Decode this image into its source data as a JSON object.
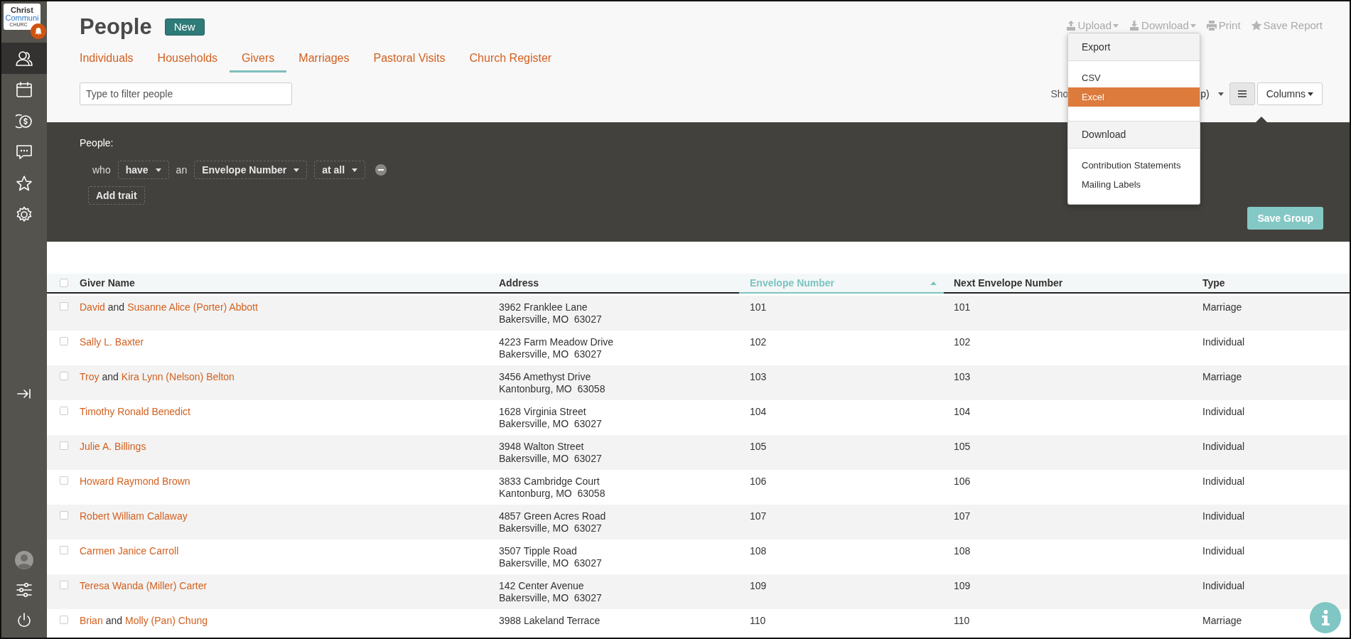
{
  "logo": {
    "lines": [
      "Christ",
      "Communi",
      "CHURC"
    ]
  },
  "sidebar": {
    "nav": [
      {
        "kind": "people",
        "selected": true
      },
      {
        "kind": "calendar",
        "selected": false
      },
      {
        "kind": "giving",
        "selected": false
      },
      {
        "kind": "messages",
        "selected": false
      },
      {
        "kind": "star",
        "selected": false
      },
      {
        "kind": "settings",
        "selected": false
      }
    ],
    "bottom": [
      {
        "kind": "avatar"
      },
      {
        "kind": "sliders"
      },
      {
        "kind": "power"
      }
    ]
  },
  "header": {
    "title": "People",
    "new_button": "New",
    "tabs": [
      {
        "label": "Individuals",
        "selected": false
      },
      {
        "label": "Households",
        "selected": false
      },
      {
        "label": "Givers",
        "selected": true
      },
      {
        "label": "Marriages",
        "selected": false
      },
      {
        "label": "Pastoral Visits",
        "selected": false
      },
      {
        "label": "Church Register",
        "selected": false
      }
    ],
    "actions": [
      {
        "kind": "upload",
        "label": "Upload",
        "caret": true
      },
      {
        "kind": "download",
        "label": "Download",
        "caret": true
      },
      {
        "kind": "print",
        "label": "Print",
        "caret": false
      },
      {
        "kind": "star",
        "label": "Save Report",
        "caret": false
      }
    ],
    "filter": {
      "placeholder": "Type to filter people"
    },
    "show_label": "Sho",
    "show_select": "p)",
    "columns_button": "Columns"
  },
  "download_menu": {
    "sections": [
      {
        "header": "Export",
        "items": [
          {
            "label": "CSV",
            "selected": false
          },
          {
            "label": "Excel",
            "selected": true
          }
        ]
      },
      {
        "header": "Download",
        "items": [
          {
            "label": "Contribution Statements",
            "selected": false
          },
          {
            "label": "Mailing Labels",
            "selected": false
          }
        ]
      }
    ]
  },
  "group_panel": {
    "heading": "People:",
    "trait": [
      {
        "kind": "word",
        "text": "who"
      },
      {
        "kind": "select",
        "text": "have"
      },
      {
        "kind": "word",
        "text": "an"
      },
      {
        "kind": "select",
        "text": "Envelope Number"
      },
      {
        "kind": "select",
        "text": "at all"
      },
      {
        "kind": "remove"
      }
    ],
    "add_trait": "Add trait",
    "save_group": {
      "label": "Save Group",
      "disabled": true
    }
  },
  "table": {
    "select_all": {
      "checked": false
    },
    "columns": [
      {
        "label": "Giver Name",
        "sorted": false
      },
      {
        "label": "Address",
        "sorted": false
      },
      {
        "label": "Envelope Number",
        "sorted": true
      },
      {
        "label": "Next Envelope Number",
        "sorted": false
      },
      {
        "label": "Type",
        "sorted": false
      }
    ],
    "rows": [
      {
        "checked": false,
        "names": [
          "David",
          "Susanne Alice (Porter) Abbott"
        ],
        "joiner": "and",
        "address": [
          "3962 Franklee Lane",
          "Bakersville, MO  63027"
        ],
        "envelope": "101",
        "next_envelope": "101",
        "type": "Marriage"
      },
      {
        "checked": false,
        "names": [
          "Sally L. Baxter"
        ],
        "address": [
          "4223 Farm Meadow Drive",
          "Bakersville, MO  63027"
        ],
        "envelope": "102",
        "next_envelope": "102",
        "type": "Individual"
      },
      {
        "checked": false,
        "names": [
          "Troy",
          "Kira Lynn (Nelson) Belton"
        ],
        "joiner": "and",
        "address": [
          "3456 Amethyst Drive",
          "Kantonburg, MO  63058"
        ],
        "envelope": "103",
        "next_envelope": "103",
        "type": "Marriage"
      },
      {
        "checked": false,
        "names": [
          "Timothy Ronald Benedict"
        ],
        "address": [
          "1628 Virginia Street",
          "Bakersville, MO  63027"
        ],
        "envelope": "104",
        "next_envelope": "104",
        "type": "Individual"
      },
      {
        "checked": false,
        "names": [
          "Julie A. Billings"
        ],
        "address": [
          "3948 Walton Street",
          "Bakersville, MO  63027"
        ],
        "envelope": "105",
        "next_envelope": "105",
        "type": "Individual"
      },
      {
        "checked": false,
        "names": [
          "Howard Raymond Brown"
        ],
        "address": [
          "3833 Cambridge Court",
          "Kantonburg, MO  63058"
        ],
        "envelope": "106",
        "next_envelope": "106",
        "type": "Individual"
      },
      {
        "checked": false,
        "names": [
          "Robert William Callaway"
        ],
        "address": [
          "4857 Green Acres Road",
          "Bakersville, MO  63027"
        ],
        "envelope": "107",
        "next_envelope": "107",
        "type": "Individual"
      },
      {
        "checked": false,
        "names": [
          "Carmen Janice Carroll"
        ],
        "address": [
          "3507 Tipple Road",
          "Bakersville, MO  63027"
        ],
        "envelope": "108",
        "next_envelope": "108",
        "type": "Individual"
      },
      {
        "checked": false,
        "names": [
          "Teresa Wanda (Miller) Carter"
        ],
        "address": [
          "142 Center Avenue",
          "Bakersville, MO  63027"
        ],
        "envelope": "109",
        "next_envelope": "109",
        "type": "Individual"
      },
      {
        "checked": false,
        "names": [
          "Brian",
          "Molly (Pan) Chung"
        ],
        "joiner": "and",
        "address": [
          "3988 Lakeland Terrace"
        ],
        "envelope": "110",
        "next_envelope": "110",
        "type": "Marriage"
      }
    ]
  }
}
